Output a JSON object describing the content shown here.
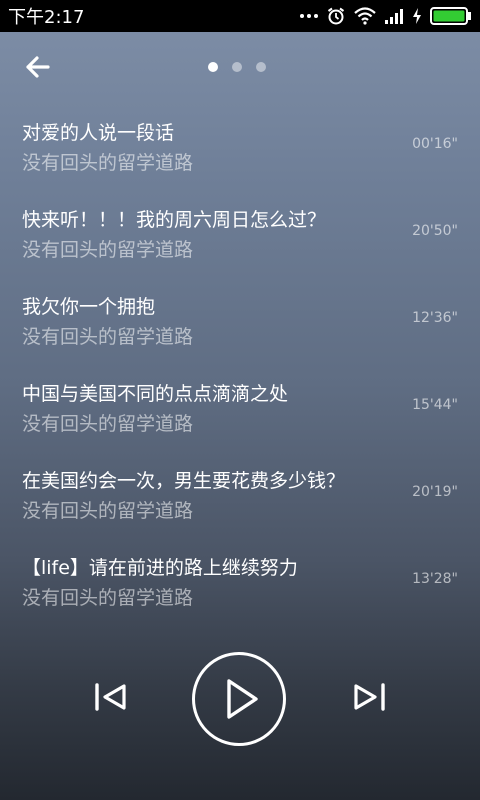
{
  "status_bar": {
    "time": "下午2:17",
    "icons": [
      "more-dots-icon",
      "alarm-icon",
      "wifi-icon",
      "signal-icon",
      "charging-icon",
      "battery-icon"
    ]
  },
  "header": {
    "pager": {
      "count": 3,
      "active_index": 0
    }
  },
  "list": {
    "items": [
      {
        "title": "对爱的人说一段话",
        "subtitle": "没有回头的留学道路",
        "duration": "00'16\""
      },
      {
        "title": "快来听！！！我的周六周日怎么过？",
        "subtitle": "没有回头的留学道路",
        "duration": "20'50\""
      },
      {
        "title": "我欠你一个拥抱",
        "subtitle": "没有回头的留学道路",
        "duration": "12'36\""
      },
      {
        "title": "中国与美国不同的点点滴滴之处",
        "subtitle": "没有回头的留学道路",
        "duration": "15'44\""
      },
      {
        "title": "在美国约会一次，男生要花费多少钱？",
        "subtitle": "没有回头的留学道路",
        "duration": "20'19\""
      },
      {
        "title": "【life】请在前进的路上继续努力",
        "subtitle": "没有回头的留学道路",
        "duration": "13'28\""
      }
    ]
  },
  "player": {
    "icons": [
      "previous-icon",
      "play-icon",
      "next-icon"
    ]
  },
  "colors": {
    "battery": "#33cc33",
    "status_bar_bg": "#000000"
  }
}
